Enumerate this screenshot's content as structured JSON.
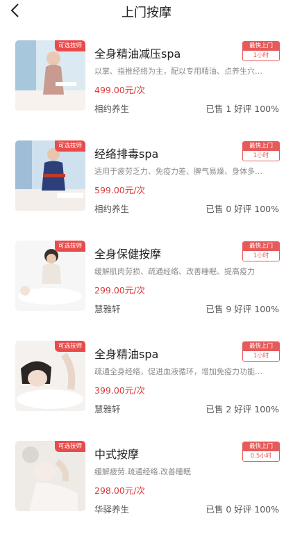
{
  "header": {
    "title": "上门按摩"
  },
  "items": [
    {
      "name": "全身精油减压spa",
      "tag": "可选技师",
      "desc": "以掌、指推经络为主，配以专用精油、点养生穴…",
      "price": "499.00元/次",
      "shop": "相约养生",
      "stats": "已售 1 好评 100%",
      "fast_label": "最快上门",
      "fast_time": "1小时",
      "photo_colors": [
        "#dbe9f2",
        "#a7c7dd",
        "#f7f2ee"
      ]
    },
    {
      "name": "经络排毒spa",
      "tag": "可选技师",
      "desc": "适用于疲劳乏力、免疫力差、脾气易燥、身体多…",
      "price": "599.00元/次",
      "shop": "相约养生",
      "stats": "已售 0 好评 100%",
      "fast_label": "最快上门",
      "fast_time": "1小时",
      "photo_colors": [
        "#cfe1ef",
        "#2d3f7a",
        "#f3eee9"
      ]
    },
    {
      "name": "全身保健按摩",
      "tag": "可选技师",
      "desc": "缓解肌肉劳损、疏通经络、改善睡眠、提高疫力",
      "price": "299.00元/次",
      "shop": "慧雅轩",
      "stats": "已售 9 好评 100%",
      "fast_label": "最快上门",
      "fast_time": "1小时",
      "photo_colors": [
        "#f6f6f6",
        "#3b3029",
        "#f4e2d6"
      ]
    },
    {
      "name": "全身精油spa",
      "tag": "可选技师",
      "desc": "疏通全身经络，促进血液循环，增加免疫力功能…",
      "price": "399.00元/次",
      "shop": "慧雅轩",
      "stats": "已售 2 好评 100%",
      "fast_label": "最快上门",
      "fast_time": "1小时",
      "photo_colors": [
        "#f4f1ee",
        "#2b2523",
        "#f1ddd0"
      ]
    },
    {
      "name": "中式按摩",
      "tag": "可选技师",
      "desc": "缓解疲劳.疏通经络.改善睡眠",
      "price": "298.00元/次",
      "shop": "华驿养生",
      "stats": "已售 0 好评 100%",
      "fast_label": "最快上门",
      "fast_time": "0.5小时",
      "photo_colors": [
        "#eeeae6",
        "#cfc8c2",
        "#f6ece6"
      ]
    }
  ]
}
